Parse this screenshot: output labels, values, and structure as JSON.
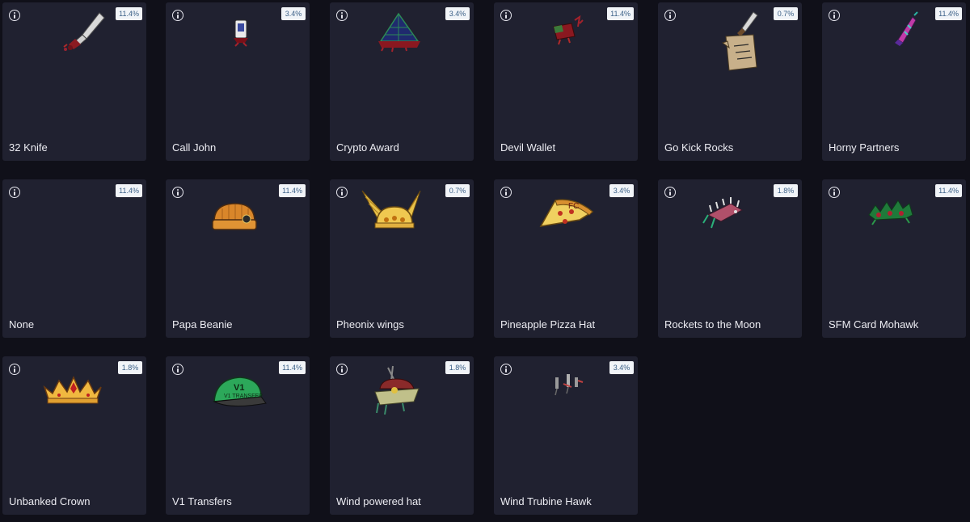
{
  "items": [
    {
      "name": "32 Knife",
      "chance": "11.4%",
      "icon": "knife-icon"
    },
    {
      "name": "Call John",
      "chance": "3.4%",
      "icon": "phone-icon"
    },
    {
      "name": "Crypto Award",
      "chance": "3.4%",
      "icon": "pyramid-award-icon"
    },
    {
      "name": "Devil Wallet",
      "chance": "11.4%",
      "icon": "wallet-icon"
    },
    {
      "name": "Go Kick Rocks",
      "chance": "0.7%",
      "icon": "sign-knife-icon"
    },
    {
      "name": "Horny Partners",
      "chance": "11.4%",
      "icon": "horn-icon"
    },
    {
      "name": "None",
      "chance": "11.4%",
      "icon": ""
    },
    {
      "name": "Papa Beanie",
      "chance": "11.4%",
      "icon": "beanie-icon"
    },
    {
      "name": "Pheonix wings",
      "chance": "0.7%",
      "icon": "winged-helmet-icon"
    },
    {
      "name": "Pineapple Pizza Hat",
      "chance": "3.4%",
      "icon": "pizza-hat-icon"
    },
    {
      "name": "Rockets to the Moon",
      "chance": "1.8%",
      "icon": "rockets-icon"
    },
    {
      "name": "SFM Card Mohawk",
      "chance": "11.4%",
      "icon": "mohawk-icon"
    },
    {
      "name": "Unbanked Crown",
      "chance": "1.8%",
      "icon": "crown-icon"
    },
    {
      "name": "V1 Transfers",
      "chance": "11.4%",
      "icon": "cap-icon",
      "cap_text": "V1 TRANSFER"
    },
    {
      "name": "Wind powered hat",
      "chance": "1.8%",
      "icon": "windmill-hat-icon"
    },
    {
      "name": "Wind Trubine Hawk",
      "chance": "3.4%",
      "icon": "turbine-icon"
    }
  ]
}
